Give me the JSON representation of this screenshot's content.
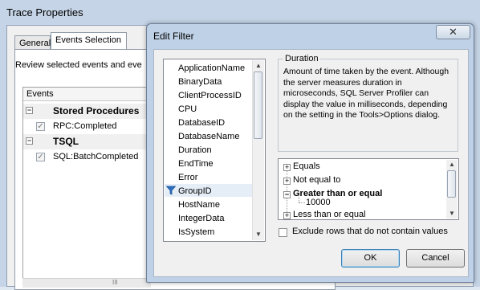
{
  "trace_properties": {
    "title": "Trace Properties",
    "tabs": [
      {
        "label": "General"
      },
      {
        "label": "Events Selection"
      }
    ],
    "review_text": "Review selected events and eve",
    "events_header": "Events",
    "groups": [
      {
        "label": "Stored Procedures",
        "expand_glyph": "−",
        "items": [
          {
            "label": "RPC:Completed",
            "checked": true
          }
        ]
      },
      {
        "label": "TSQL",
        "expand_glyph": "−",
        "items": [
          {
            "label": "SQL:BatchCompleted",
            "checked": true
          }
        ]
      }
    ],
    "scroll_glyph": "III"
  },
  "edit_filter": {
    "title": "Edit Filter",
    "close_glyph": "✕",
    "columns": [
      "ApplicationName",
      "BinaryData",
      "ClientProcessID",
      "CPU",
      "DatabaseID",
      "DatabaseName",
      "Duration",
      "EndTime",
      "Error",
      "GroupID",
      "HostName",
      "IntegerData",
      "IsSystem"
    ],
    "selected_column": "Duration",
    "description": {
      "heading": "Duration",
      "text": "Amount of time taken by the event. Although the server measures duration in microseconds, SQL Server Profiler can display the value in milliseconds, depending on the setting in the Tools>Options dialog."
    },
    "operators": [
      {
        "label": "Equals",
        "glyph": "+",
        "bold": false
      },
      {
        "label": "Not equal to",
        "glyph": "+",
        "bold": false
      },
      {
        "label": "Greater than or equal",
        "glyph": "−",
        "bold": true
      },
      {
        "label": "Less than or equal",
        "glyph": "+",
        "bold": false
      }
    ],
    "operator_value": "10000",
    "exclude_label": "Exclude rows that do not contain values",
    "exclude_checked": false,
    "ok_label": "OK",
    "cancel_label": "Cancel",
    "accent_color": "#3c7fb1",
    "filter_icon_color": "#2a6fc4"
  }
}
